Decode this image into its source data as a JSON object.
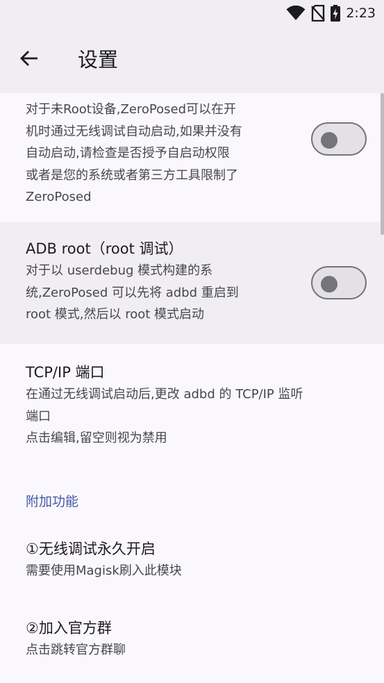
{
  "status_bar": {
    "time": "2:23",
    "icons": [
      "wifi-icon",
      "no-sim-icon",
      "battery-charging-icon"
    ]
  },
  "app_bar": {
    "title": "设置",
    "back_icon": "arrow-back-icon"
  },
  "preferences": {
    "non_root_autostart": {
      "summary_lines": [
        "对于未Root设备,ZeroPosed可以在开",
        "机时通过无线调试自动启动,如果并没有",
        "自动启动,请检查是否授予自启动权限",
        "或者是您的系统或者第三方工具限制了",
        "ZeroPosed"
      ],
      "enabled": false
    },
    "adb_root": {
      "title": "ADB root（root 调试）",
      "summary_lines": [
        "对于以 userdebug 模式构建的系",
        "统,ZeroPosed 可以先将 adbd 重启到",
        "root 模式,然后以 root 模式启动"
      ],
      "enabled": false
    },
    "tcp_port": {
      "title": "TCP/IP 端口",
      "summary_lines": [
        "在通过无线调试启动后,更改 adbd 的 TCP/IP 监听",
        "端口",
        "点击编辑,留空则视为禁用"
      ]
    }
  },
  "extras": {
    "category_title": "附加功能",
    "items": [
      {
        "title": "①无线调试永久开启",
        "summary": "需要使用Magisk刷入此模块"
      },
      {
        "title": "②加入官方群",
        "summary": "点击跳转官方群聊"
      }
    ]
  },
  "colors": {
    "background": "#fbf8fd",
    "app_bar": "#f1eef3",
    "highlight_row": "#f1eef3",
    "accent": "#4359a8",
    "switch_outline": "#75747c",
    "switch_track": "#e4e1e6"
  }
}
